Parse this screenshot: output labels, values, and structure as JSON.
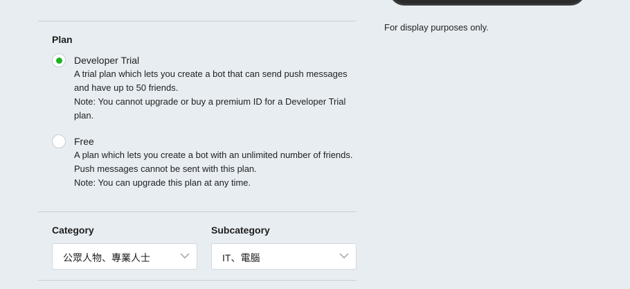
{
  "preview": {
    "note": "For display purposes only."
  },
  "plan": {
    "title": "Plan",
    "options": [
      {
        "name": "Developer Trial",
        "selected": true,
        "description": "A trial plan which lets you create a bot that can send push messages and have up to 50 friends.",
        "note": "Note: You cannot upgrade or buy a premium ID for a Developer Trial plan."
      },
      {
        "name": "Free",
        "selected": false,
        "description": "A plan which lets you create a bot with an unlimited number of friends. Push messages cannot be sent with this plan.",
        "note": "Note: You can upgrade this plan at any time."
      }
    ]
  },
  "category": {
    "label": "Category",
    "value": "公眾人物、專業人士"
  },
  "subcategory": {
    "label": "Subcategory",
    "value": "IT、電腦"
  },
  "colors": {
    "accent": "#1db423",
    "background": "#e8edf1"
  },
  "icons": {
    "select_arrow": "chevron-down-icon"
  }
}
